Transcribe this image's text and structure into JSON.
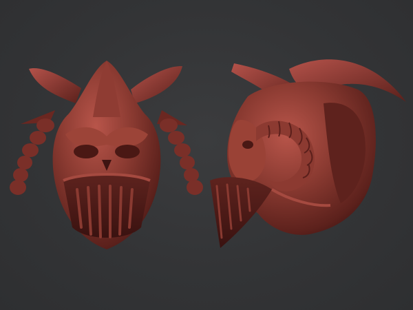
{
  "scene": {
    "background_color": "#333436",
    "clay_base": "#7a2e27",
    "clay_light": "#b8554a",
    "clay_dark": "#3e1412",
    "objects": [
      {
        "id": "helmet-front-view",
        "view": "front"
      },
      {
        "id": "helmet-side-view",
        "view": "side"
      }
    ]
  }
}
